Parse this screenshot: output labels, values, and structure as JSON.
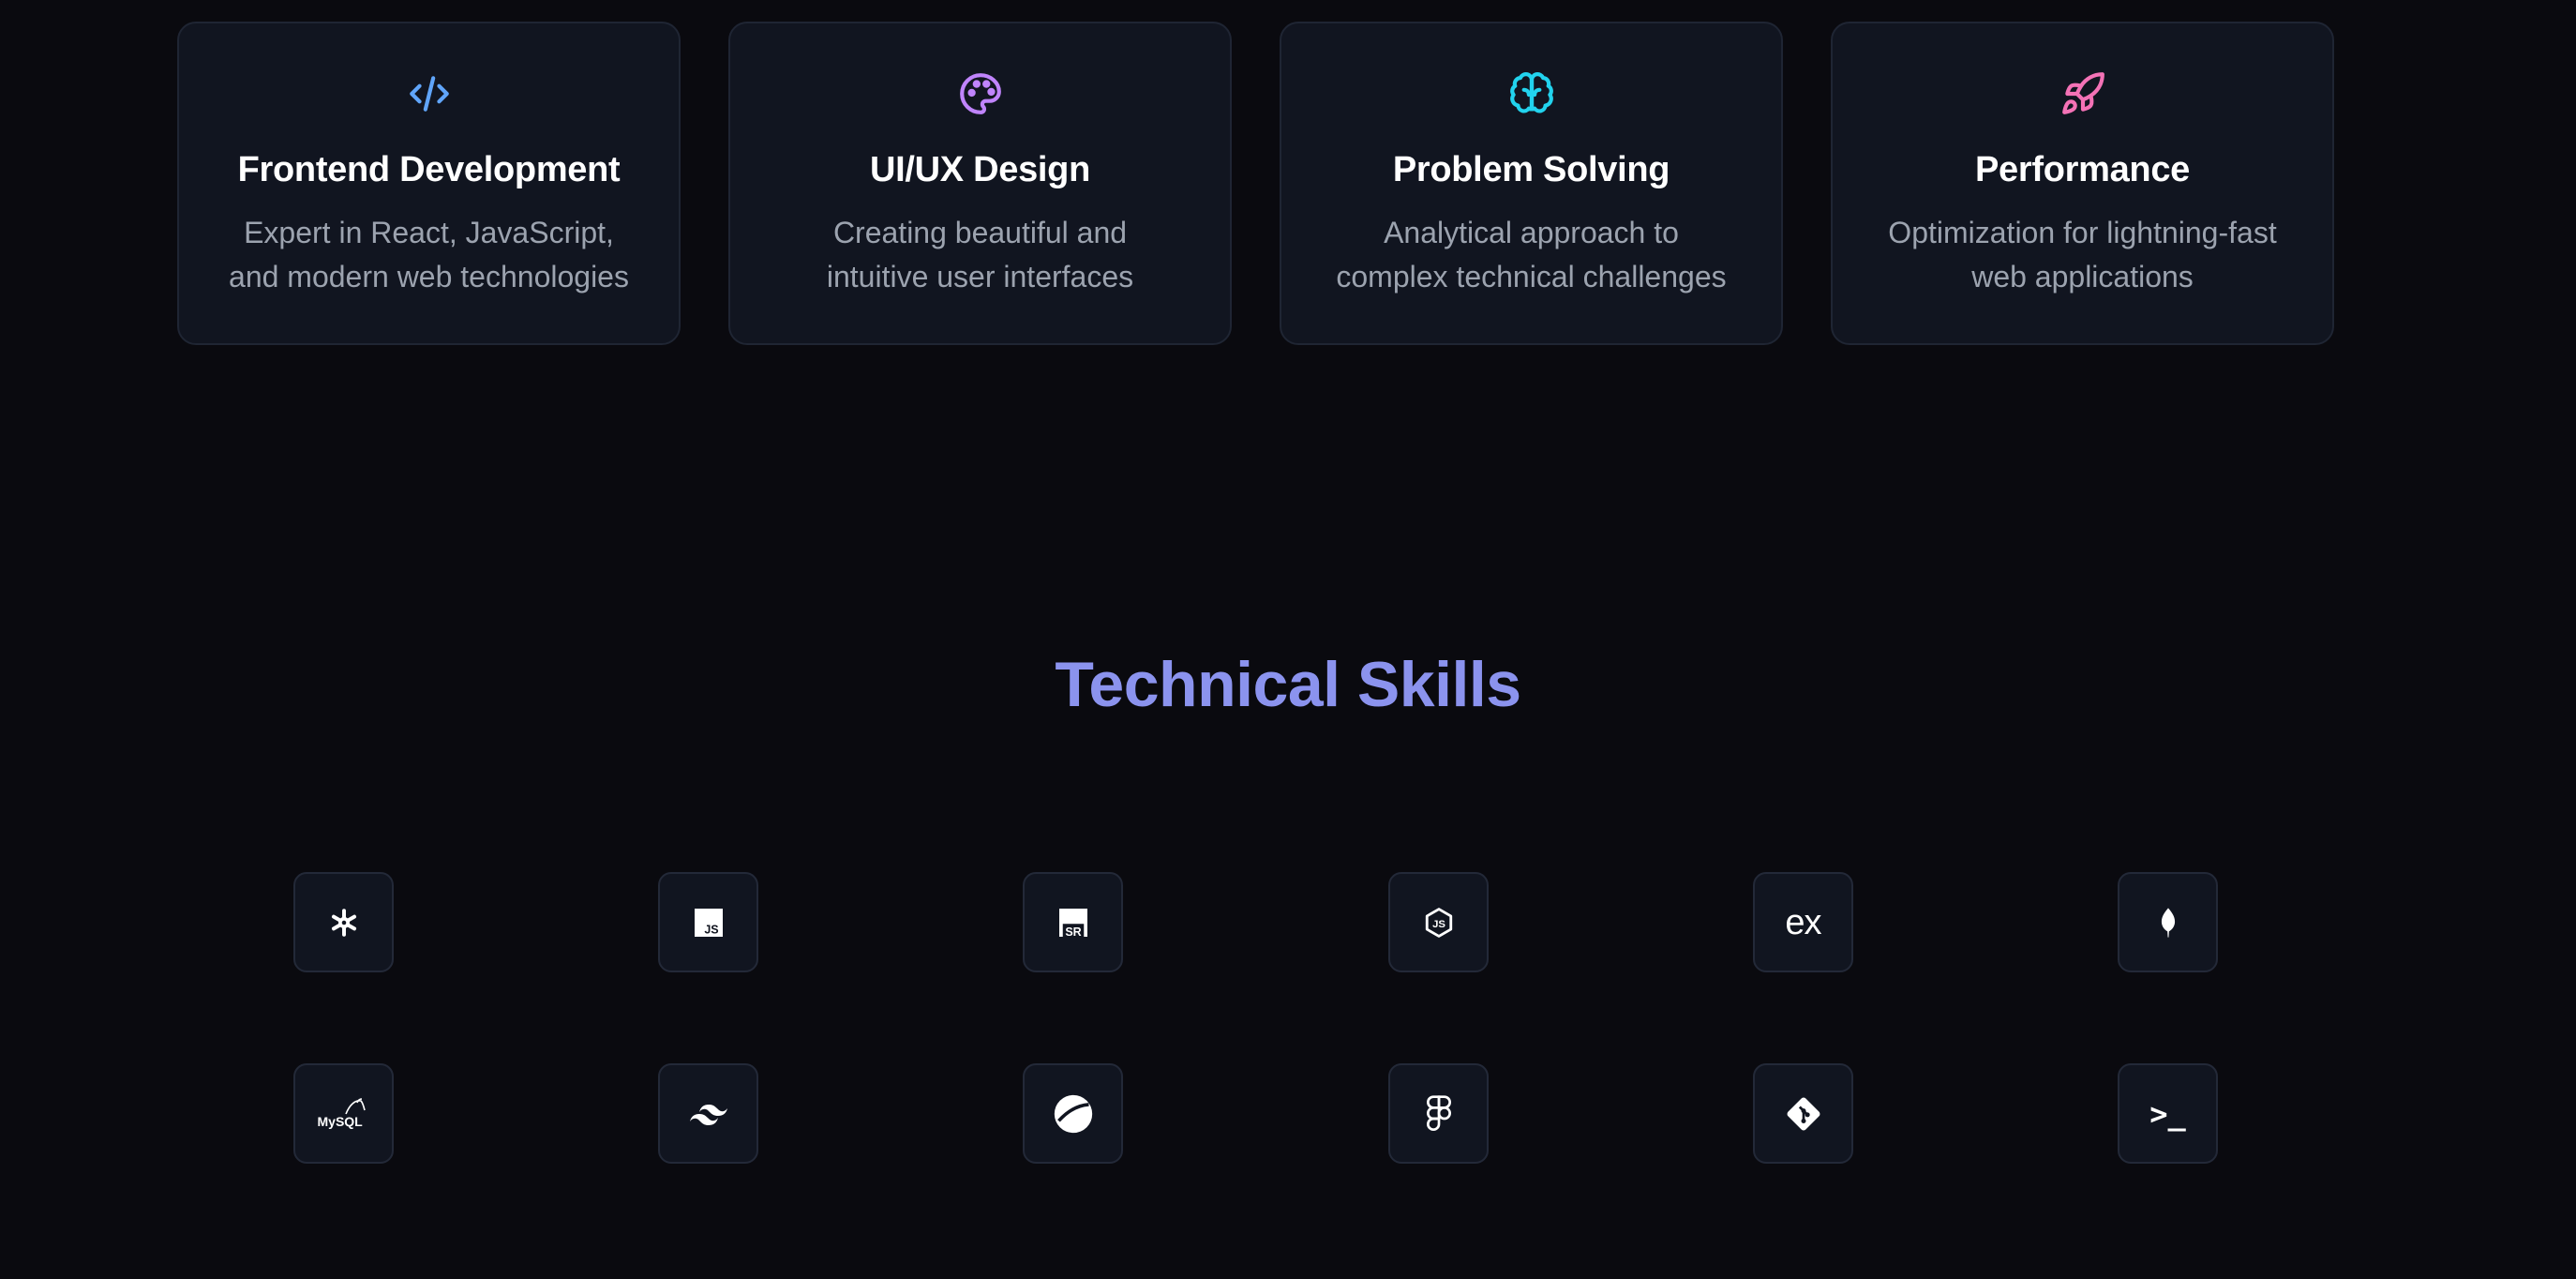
{
  "features": [
    {
      "icon": "code-icon",
      "icon_color": "#60a5fa",
      "title": "Frontend Development",
      "desc_line1": "Expert in React, JavaScript,",
      "desc_line2": "and modern web technologies"
    },
    {
      "icon": "palette-icon",
      "icon_color": "#c084fc",
      "title": "UI/UX Design",
      "desc_line1": "Creating beautiful and",
      "desc_line2": "intuitive user interfaces"
    },
    {
      "icon": "brain-icon",
      "icon_color": "#22d3ee",
      "title": "Problem Solving",
      "desc_line1": "Analytical approach to",
      "desc_line2": "complex technical challenges"
    },
    {
      "icon": "rocket-icon",
      "icon_color": "#f472b6",
      "title": "Performance",
      "desc_line1": "Optimization for lightning-fast",
      "desc_line2": "web applications"
    }
  ],
  "skills_section": {
    "title": "Technical Skills",
    "title_color": "#8b93ee"
  },
  "skills": [
    {
      "icon": "react-icon"
    },
    {
      "icon": "javascript-icon"
    },
    {
      "icon": "standardjs-icon"
    },
    {
      "icon": "nodejs-icon"
    },
    {
      "icon": "express-icon",
      "text": "ex"
    },
    {
      "icon": "mongodb-icon"
    },
    {
      "icon": "mysql-icon",
      "text": "MySQL"
    },
    {
      "icon": "tailwind-icon"
    },
    {
      "icon": "next-icon"
    },
    {
      "icon": "figma-icon"
    },
    {
      "icon": "git-icon"
    },
    {
      "icon": "terminal-icon",
      "text": ">_"
    }
  ]
}
